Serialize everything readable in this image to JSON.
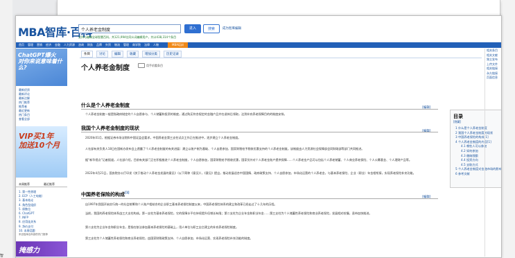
{
  "site": {
    "logo": "MBA智库·百科",
    "search_value": "个人养老金制度",
    "enter_label": "进入",
    "search_label": "搜索",
    "help_label": "成为智库编辑",
    "stats": "支持与编辑全球智慧百科，共121,994位同义词编辑用户，共计438,314个条目"
  },
  "nav": [
    "首页",
    "管理",
    "营销",
    "经济",
    "金融",
    "人力资源",
    "咨询",
    "财务",
    "品牌",
    "外贸",
    "物流",
    "管理",
    "商学院",
    "法律",
    "人物",
    "MBA培训"
  ],
  "sidebar": {
    "ad1": "ChatGPT爆火\n对你来说意味着什么?",
    "links": [
      "最新优质",
      "最新评论",
      "最新注解",
      "热门推荐",
      "推荐者",
      "最近更新",
      "热门条目",
      "查看全部"
    ],
    "ad2": "VIP买1年\n加送10个月",
    "tab1": "本周推荐",
    "tab2": "最近推荐",
    "list": [
      "1. 第一性原理",
      "2. ECP（人工电能）",
      "3. 基本结论",
      "4. 角色型组织",
      "5. 原数位",
      "6. ChatGPT",
      "7. INFP",
      "8. 应用连关系",
      "9. 净价支付",
      "10. 本周话题"
    ],
    "footer": "来自智库百科部的热门推荐",
    "ad3": "掩感力"
  },
  "article": {
    "tabs": [
      "条目",
      "讨论",
      "编辑",
      "收藏",
      "增加分类",
      "历史记录"
    ],
    "title": "个人养老金制度",
    "subtitle": "用手机看条目",
    "edit_label": "[编辑]",
    "sections": [
      {
        "heading": "什么是个人养老金制度",
        "paras": [
          "个人养老金制度一般是指政府制定的个人自愿参与、个人储蓄和投资的制度，通过购买符合规定的金融产品并在退休后领取，达到补充养老保障目的的制度安排。"
        ]
      },
      {
        "heading": "我国个人养老金制度的现状",
        "paras": [
          "2020年01月，根据证券市场法院和中国证监会要求，中国养老金第三支柱试点工作正在推进中，逐步建立个人养老金制度。",
          "人社部有关负责人18日在国新办发布会上透露了个人养老金制度的有关进展：建立以账户制为基础、个人自愿参加、国家财税给予税收优惠支持的个人养老金制度。该制度由人力资源社会保障部会同财政部等部门共同推进。",
          "据“新华视点”记者报道，人社部介绍，目前有关部门正在积极推进个人养老金制度，个人自愿参加，国家财税给予税收优惠，国家另外对个人养老金账户提供保障……个人养老金产品可以包括个人养老储蓄、个人商业养老保险、个人公募基金、个人理财产品等。",
          "2022年4月21日，国务院办公厅印发《关于推动个人养老金发展的意见》（以下简称《意见》），《意见》提出，推动发展适合中国国情、政府政策支持、个人自愿参加、市场化运营的个人养老金，与基本养老保险、企业（职业）年金相衔接，实现养老保险补充功能。"
        ]
      },
      {
        "heading": "中国养老保险的构成",
        "sup": "[1]",
        "paras": [
          "自1997年我国开始实行统一的社会统筹和个人账户相结合的企业职工基本养老保险制度以来，中国养老保险体系的建立和改革已经走过了十几年的历程。",
          "当前，我国的养老保险体系由三大支柱构成。第一支柱为基本养老保险，它的保障水平在持续提升但增长有限；第二支柱为企业年金和职业年金……第三支柱为个人储蓄性养老保险和商业养老保险，发展相对较慢，亟待加快推进。",
          "第二支柱为企业年金和职业年金，是指在依法参加基本养老保险的基础上，用人单位与职工自主建立的补充养老保险制度。",
          "第三支柱为个人储蓄性养老保险和商业养老保险，由国家财税政策支持、个人自愿参加、市场化运营、实现养老保险补充功能的制度。"
        ]
      }
    ]
  },
  "toc": {
    "heading": "目录",
    "hide": "[隐藏]",
    "items": [
      {
        "label": "1 什么是个人养老金制度",
        "sub": false
      },
      {
        "label": "2 我国个人养老金制度的现状",
        "sub": false
      },
      {
        "label": "3 中国养老保险的构成[1]",
        "sub": false
      },
      {
        "label": "4 个人养老金制度的内容[1]",
        "sub": false
      },
      {
        "label": "4.1 哪些人可以参加",
        "sub": true
      },
      {
        "label": "4.2 如何参加",
        "sub": true
      },
      {
        "label": "4.3 缴纳限额",
        "sub": true
      },
      {
        "label": "4.4 投资方向",
        "sub": true
      },
      {
        "label": "4.5 支取方式",
        "sub": true
      },
      {
        "label": "5 个人养老金制度对金融市场的影响[2]",
        "sub": false
      },
      {
        "label": "6 参考文献",
        "sub": false
      }
    ]
  },
  "right_sidebar": [
    "相关条目",
    "相关文献",
    "独立发布",
    "上传文件",
    "相关链接",
    "永久链接",
    "页面信息"
  ],
  "corner_label": "智"
}
